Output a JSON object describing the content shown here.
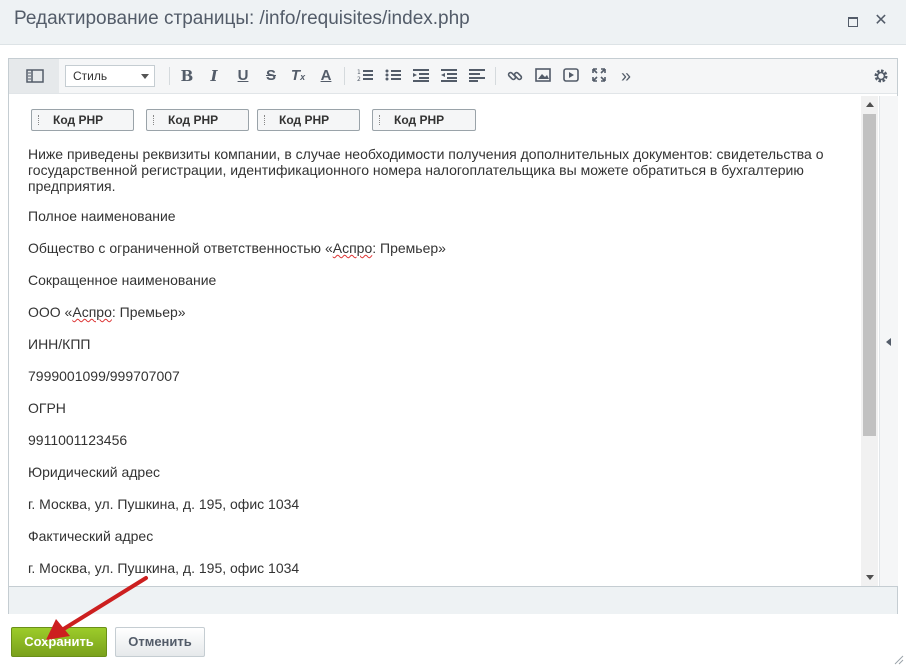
{
  "window": {
    "title": "Редактирование страницы: /info/requisites/index.php"
  },
  "toolbar": {
    "style_select": "Стиль",
    "buttons": [
      "mode-toggle",
      "bold",
      "italic",
      "underline",
      "strikethrough",
      "remove-format",
      "font-color",
      "ordered-list",
      "unordered-list",
      "indent",
      "outdent",
      "align",
      "link",
      "image",
      "video",
      "fullscreen",
      "more",
      "settings"
    ]
  },
  "content": {
    "php_blocks": [
      "Код PHP",
      "Код PHP",
      "Код PHP",
      "Код PHP"
    ],
    "intro": "Ниже приведены реквизиты компании, в случае необходимости получения дополнительных документов: свидетельства о государственной регистрации, идентификационного номера налогоплательщика вы можете обратиться в бухгалтерию предприятия.",
    "paragraphs": [
      "Полное наименование",
      "Общество с ограниченной ответственностью «Аспро: Премьер»",
      "Сокращенное наименование",
      "ООО «Аспро: Премьер»",
      "ИНН/КПП",
      "7999001099/999707007",
      "ОГРН",
      "9911001123456",
      "Юридический адрес",
      "г. Москва, ул. Пушкина, д. 195, офис 1034",
      "Фактический адрес",
      "г. Москва, ул. Пушкина, д. 195, офис 1034"
    ]
  },
  "actions": {
    "save_label": "Сохранить",
    "cancel_label": "Отменить"
  },
  "colors": {
    "save_button": "#8cb824",
    "annotation_arrow": "#cc1f1f",
    "titlebar": "#eef2f4"
  }
}
